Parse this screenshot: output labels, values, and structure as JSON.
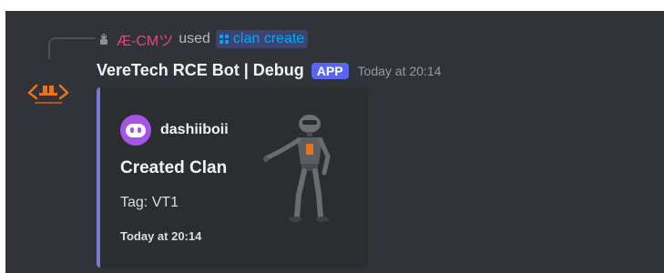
{
  "reply": {
    "user": "Æ-CMツ",
    "used_text": "used",
    "command": "clan create"
  },
  "message": {
    "bot_name": "VereTech RCE Bot | Debug",
    "badge": "APP",
    "timestamp": "Today at 20:14"
  },
  "embed": {
    "author": "dashiiboii",
    "title": "Created Clan",
    "field": "Tag: VT1",
    "footer": "Today at 20:14",
    "accent_color": "#6f7bd6"
  },
  "icons": {
    "avatar": "veretech-logo-icon",
    "reply_user_icon": "bot-mini-icon",
    "command_icon": "slash-command-grid-icon",
    "author_icon": "discord-clyde-icon",
    "thumbnail": "robot-thumbnail-icon"
  }
}
